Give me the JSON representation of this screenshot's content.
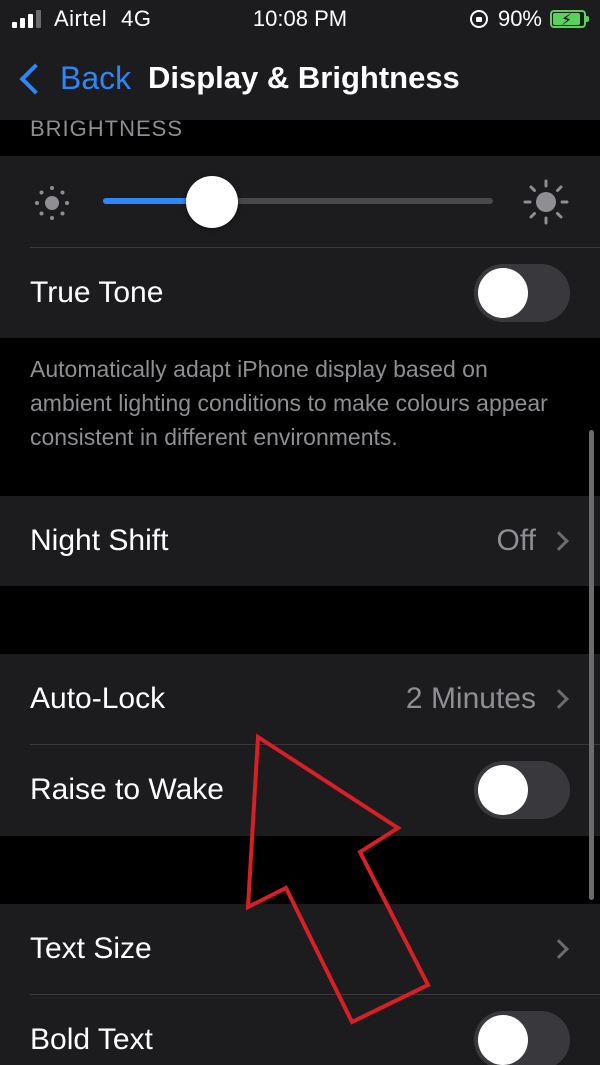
{
  "status_bar": {
    "carrier": "Airtel",
    "network": "4G",
    "time": "10:08 PM",
    "battery_percent": "90%",
    "signal_bars_active": 3,
    "battery_level": 0.9
  },
  "nav": {
    "back_label": "Back",
    "title": "Display & Brightness"
  },
  "brightness": {
    "section_header": "BRIGHTNESS",
    "level": 0.28
  },
  "true_tone": {
    "label": "True Tone",
    "on": false,
    "description": "Automatically adapt iPhone display based on ambient lighting conditions to make colours appear consistent in different environments."
  },
  "night_shift": {
    "label": "Night Shift",
    "value": "Off"
  },
  "auto_lock": {
    "label": "Auto-Lock",
    "value": "2 Minutes"
  },
  "raise_to_wake": {
    "label": "Raise to Wake",
    "on": false
  },
  "text_size": {
    "label": "Text Size"
  },
  "bold_text": {
    "label": "Bold Text",
    "on": false
  },
  "colors": {
    "accent": "#2f86f6",
    "background": "#000000",
    "cell": "#1c1c1e",
    "secondary_text": "#8e8e93",
    "toggle_off": "#39393d",
    "battery": "#5bd05b",
    "annotation": "#d61f26"
  }
}
